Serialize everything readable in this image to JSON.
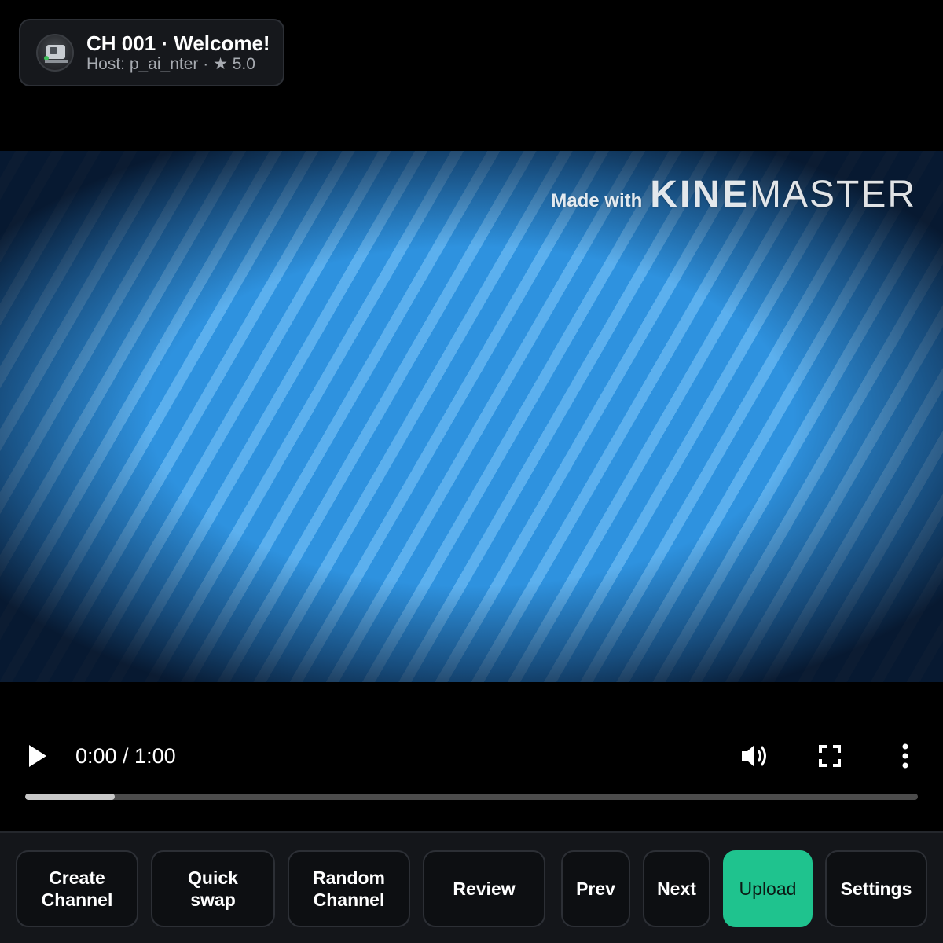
{
  "channel": {
    "title": "CH 001 · Welcome!",
    "subtitle": "Host: p_ai_nter · ★ 5.0"
  },
  "video": {
    "watermark_made": "Made with",
    "watermark_kine": "KINE",
    "watermark_master": "MASTER"
  },
  "player": {
    "time": "0:00 / 1:00",
    "progress_fraction": 0.1,
    "play_icon": "play-icon",
    "volume_icon": "volume-icon",
    "fullscreen_icon": "fullscreen-icon",
    "more_icon": "more-vert-icon"
  },
  "toolbar": {
    "create_channel": "Create\nChannel",
    "quick_swap": "Quick\nswap",
    "random_channel": "Random\nChannel",
    "review": "Review",
    "prev": "Prev",
    "next": "Next",
    "upload": "Upload",
    "settings": "Settings"
  },
  "colors": {
    "accent": "#1fc38e",
    "panel": "#14161a",
    "video_stripe_dark": "#2e92df",
    "video_stripe_light": "#5cb0ee"
  }
}
